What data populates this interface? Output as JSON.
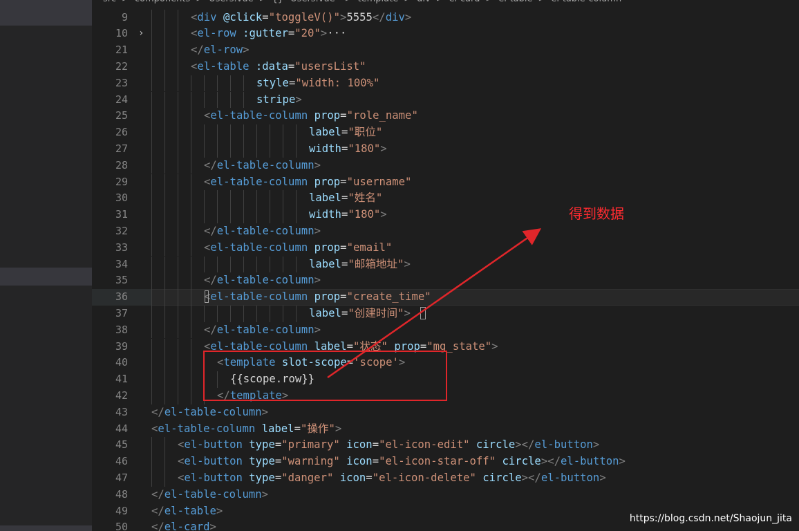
{
  "breadcrumb": [
    "src",
    ">",
    "components",
    ">",
    "Users.vue",
    ">",
    "{} \"Users.vue\"",
    ">",
    "template",
    ">",
    "div",
    ">",
    "el-card",
    ">",
    "el-table",
    ">",
    "el-table-column"
  ],
  "lines": [
    {
      "n": "9",
      "indent": 3,
      "tokens": [
        [
          "p",
          "<"
        ],
        [
          "t",
          "div"
        ],
        [
          "x",
          " "
        ],
        [
          "a",
          "@click"
        ],
        [
          "x",
          "="
        ],
        [
          "s",
          "\"toggleV()\""
        ],
        [
          "p",
          ">"
        ],
        [
          "x",
          "5555"
        ],
        [
          "p",
          "</"
        ],
        [
          "t",
          "div"
        ],
        [
          "p",
          ">"
        ]
      ]
    },
    {
      "n": "10",
      "indent": 3,
      "fold": "›",
      "tokens": [
        [
          "p",
          "<"
        ],
        [
          "t",
          "el-row"
        ],
        [
          "x",
          " "
        ],
        [
          "a",
          ":gutter"
        ],
        [
          "x",
          "="
        ],
        [
          "s",
          "\"20\""
        ],
        [
          "p",
          ">"
        ],
        [
          "x",
          "···"
        ]
      ]
    },
    {
      "n": "21",
      "indent": 3,
      "tokens": [
        [
          "p",
          "</"
        ],
        [
          "t",
          "el-row"
        ],
        [
          "p",
          ">"
        ]
      ]
    },
    {
      "n": "22",
      "indent": 3,
      "tokens": [
        [
          "p",
          "<"
        ],
        [
          "t",
          "el-table"
        ],
        [
          "x",
          " "
        ],
        [
          "a",
          ":data"
        ],
        [
          "x",
          "="
        ],
        [
          "s",
          "\"usersList\""
        ]
      ]
    },
    {
      "n": "23",
      "indent": 8,
      "tokens": [
        [
          "a",
          "style"
        ],
        [
          "x",
          "="
        ],
        [
          "s",
          "\"width: 100%\""
        ]
      ]
    },
    {
      "n": "24",
      "indent": 8,
      "tokens": [
        [
          "a",
          "stripe"
        ],
        [
          "p",
          ">"
        ]
      ]
    },
    {
      "n": "25",
      "indent": 4,
      "tokens": [
        [
          "p",
          "<"
        ],
        [
          "t",
          "el-table-column"
        ],
        [
          "x",
          " "
        ],
        [
          "a",
          "prop"
        ],
        [
          "x",
          "="
        ],
        [
          "s",
          "\"role_name\""
        ]
      ]
    },
    {
      "n": "26",
      "indent": 12,
      "tokens": [
        [
          "a",
          "label"
        ],
        [
          "x",
          "="
        ],
        [
          "s",
          "\"职位\""
        ]
      ]
    },
    {
      "n": "27",
      "indent": 12,
      "tokens": [
        [
          "a",
          "width"
        ],
        [
          "x",
          "="
        ],
        [
          "s",
          "\"180\""
        ],
        [
          "p",
          ">"
        ]
      ]
    },
    {
      "n": "28",
      "indent": 4,
      "tokens": [
        [
          "p",
          "</"
        ],
        [
          "t",
          "el-table-column"
        ],
        [
          "p",
          ">"
        ]
      ]
    },
    {
      "n": "29",
      "indent": 4,
      "tokens": [
        [
          "p",
          "<"
        ],
        [
          "t",
          "el-table-column"
        ],
        [
          "x",
          " "
        ],
        [
          "a",
          "prop"
        ],
        [
          "x",
          "="
        ],
        [
          "s",
          "\"username\""
        ]
      ]
    },
    {
      "n": "30",
      "indent": 12,
      "tokens": [
        [
          "a",
          "label"
        ],
        [
          "x",
          "="
        ],
        [
          "s",
          "\"姓名\""
        ]
      ]
    },
    {
      "n": "31",
      "indent": 12,
      "tokens": [
        [
          "a",
          "width"
        ],
        [
          "x",
          "="
        ],
        [
          "s",
          "\"180\""
        ],
        [
          "p",
          ">"
        ]
      ]
    },
    {
      "n": "32",
      "indent": 4,
      "tokens": [
        [
          "p",
          "</"
        ],
        [
          "t",
          "el-table-column"
        ],
        [
          "p",
          ">"
        ]
      ]
    },
    {
      "n": "33",
      "indent": 4,
      "tokens": [
        [
          "p",
          "<"
        ],
        [
          "t",
          "el-table-column"
        ],
        [
          "x",
          " "
        ],
        [
          "a",
          "prop"
        ],
        [
          "x",
          "="
        ],
        [
          "s",
          "\"email\""
        ]
      ]
    },
    {
      "n": "34",
      "indent": 12,
      "tokens": [
        [
          "a",
          "label"
        ],
        [
          "x",
          "="
        ],
        [
          "s",
          "\"邮箱地址\""
        ],
        [
          "p",
          ">"
        ]
      ]
    },
    {
      "n": "35",
      "indent": 4,
      "tokens": [
        [
          "p",
          "</"
        ],
        [
          "t",
          "el-table-column"
        ],
        [
          "p",
          ">"
        ]
      ]
    },
    {
      "n": "36",
      "indent": 4,
      "hl": true,
      "tokens": [
        [
          "p",
          "<"
        ],
        [
          "t",
          "el-table-column"
        ],
        [
          "x",
          " "
        ],
        [
          "a",
          "prop"
        ],
        [
          "x",
          "="
        ],
        [
          "s",
          "\"create_time\""
        ]
      ]
    },
    {
      "n": "37",
      "indent": 12,
      "tokens": [
        [
          "a",
          "label"
        ],
        [
          "x",
          "="
        ],
        [
          "s",
          "\"创建时间\""
        ],
        [
          "p",
          ">"
        ]
      ]
    },
    {
      "n": "38",
      "indent": 4,
      "tokens": [
        [
          "p",
          "</"
        ],
        [
          "t",
          "el-table-column"
        ],
        [
          "p",
          ">"
        ]
      ]
    },
    {
      "n": "39",
      "indent": 4,
      "tokens": [
        [
          "p",
          "<"
        ],
        [
          "t",
          "el-table-column"
        ],
        [
          "x",
          " "
        ],
        [
          "a",
          "label"
        ],
        [
          "x",
          "="
        ],
        [
          "s",
          "\"状态\""
        ],
        [
          "x",
          " "
        ],
        [
          "a",
          "prop"
        ],
        [
          "x",
          "="
        ],
        [
          "s",
          "\"mg_state\""
        ],
        [
          "p",
          ">"
        ]
      ]
    },
    {
      "n": "40",
      "indent": 5,
      "tokens": [
        [
          "p",
          "<"
        ],
        [
          "t",
          "template"
        ],
        [
          "x",
          " "
        ],
        [
          "a",
          "slot-scope"
        ],
        [
          "x",
          "="
        ],
        [
          "s",
          "'scope'"
        ],
        [
          "p",
          ">"
        ]
      ]
    },
    {
      "n": "41",
      "indent": 6,
      "tokens": [
        [
          "x",
          "{{scope.row}}"
        ]
      ]
    },
    {
      "n": "42",
      "indent": 5,
      "tokens": [
        [
          "p",
          "</"
        ],
        [
          "t",
          "template"
        ],
        [
          "p",
          ">"
        ]
      ]
    },
    {
      "n": "43",
      "indent": 0,
      "tokens": [
        [
          "p",
          "</"
        ],
        [
          "t",
          "el-table-column"
        ],
        [
          "p",
          ">"
        ]
      ]
    },
    {
      "n": "44",
      "indent": 0,
      "tokens": [
        [
          "p",
          "<"
        ],
        [
          "t",
          "el-table-column"
        ],
        [
          "x",
          " "
        ],
        [
          "a",
          "label"
        ],
        [
          "x",
          "="
        ],
        [
          "s",
          "\"操作\""
        ],
        [
          "p",
          ">"
        ]
      ]
    },
    {
      "n": "45",
      "indent": 2,
      "tokens": [
        [
          "p",
          "<"
        ],
        [
          "t",
          "el-button"
        ],
        [
          "x",
          " "
        ],
        [
          "a",
          "type"
        ],
        [
          "x",
          "="
        ],
        [
          "s",
          "\"primary\""
        ],
        [
          "x",
          " "
        ],
        [
          "a",
          "icon"
        ],
        [
          "x",
          "="
        ],
        [
          "s",
          "\"el-icon-edit\""
        ],
        [
          "x",
          " "
        ],
        [
          "a",
          "circle"
        ],
        [
          "p",
          ">"
        ],
        [
          "p",
          "</"
        ],
        [
          "t",
          "el-button"
        ],
        [
          "p",
          ">"
        ]
      ]
    },
    {
      "n": "46",
      "indent": 2,
      "tokens": [
        [
          "p",
          "<"
        ],
        [
          "t",
          "el-button"
        ],
        [
          "x",
          " "
        ],
        [
          "a",
          "type"
        ],
        [
          "x",
          "="
        ],
        [
          "s",
          "\"warning\""
        ],
        [
          "x",
          " "
        ],
        [
          "a",
          "icon"
        ],
        [
          "x",
          "="
        ],
        [
          "s",
          "\"el-icon-star-off\""
        ],
        [
          "x",
          " "
        ],
        [
          "a",
          "circle"
        ],
        [
          "p",
          ">"
        ],
        [
          "p",
          "</"
        ],
        [
          "t",
          "el-button"
        ],
        [
          "p",
          ">"
        ]
      ]
    },
    {
      "n": "47",
      "indent": 2,
      "tokens": [
        [
          "p",
          "<"
        ],
        [
          "t",
          "el-button"
        ],
        [
          "x",
          " "
        ],
        [
          "a",
          "type"
        ],
        [
          "x",
          "="
        ],
        [
          "s",
          "\"danger\""
        ],
        [
          "x",
          " "
        ],
        [
          "a",
          "icon"
        ],
        [
          "x",
          "="
        ],
        [
          "s",
          "\"el-icon-delete\""
        ],
        [
          "x",
          " "
        ],
        [
          "a",
          "circle"
        ],
        [
          "p",
          ">"
        ],
        [
          "p",
          "</"
        ],
        [
          "t",
          "el-button"
        ],
        [
          "p",
          ">"
        ]
      ]
    },
    {
      "n": "48",
      "indent": 0,
      "tokens": [
        [
          "p",
          "</"
        ],
        [
          "t",
          "el-table-column"
        ],
        [
          "p",
          ">"
        ]
      ]
    },
    {
      "n": "49",
      "indent": 0,
      "tokens": [
        [
          "p",
          "</"
        ],
        [
          "t",
          "el-table"
        ],
        [
          "p",
          ">"
        ]
      ]
    },
    {
      "n": "50",
      "indent": 0,
      "tokens": [
        [
          "p",
          "</"
        ],
        [
          "t",
          "el-card"
        ],
        [
          "p",
          ">"
        ]
      ]
    }
  ],
  "annotation": {
    "text": "得到数据",
    "color": "#ff2b30"
  },
  "watermark": "https://blog.csdn.net/Shaojun_jita",
  "colors": {
    "tag": "#569cd6",
    "attr": "#9cdcfe",
    "string": "#ce9178",
    "punct": "#808080",
    "text": "#d4d4d4",
    "highlight_box": "#e0262a"
  }
}
